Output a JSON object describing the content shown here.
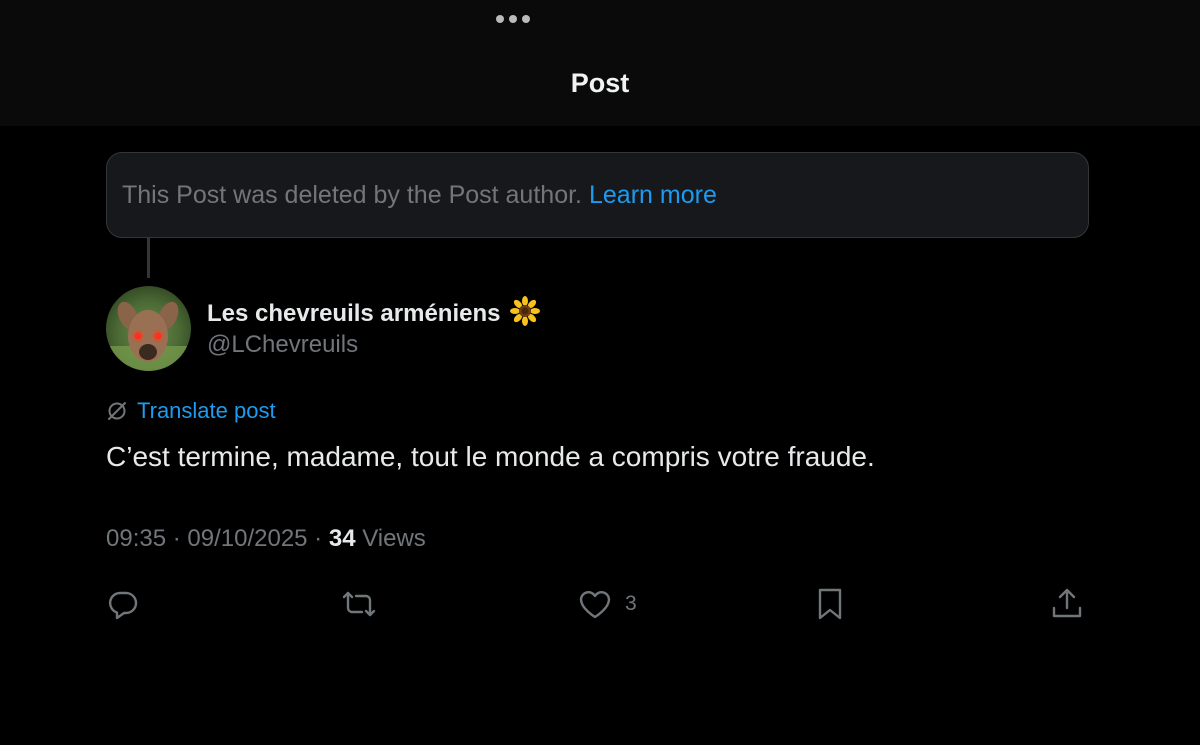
{
  "header": {
    "title": "Post",
    "grabber_icon": "more-dots-icon"
  },
  "deleted_notice": {
    "text": "This Post was deleted by the Post author.",
    "link": "Learn more"
  },
  "author": {
    "display_name": "Les chevreuils arméniens",
    "badge_emoji": "🌻",
    "handle": "@LChevreuils",
    "avatar_icon": "deer-avatar"
  },
  "translate_label": "Translate post",
  "post": {
    "text": "C’est termine, madame, tout le monde a compris votre fraude."
  },
  "meta": {
    "time": "09:35",
    "separator": " · ",
    "date": "09/10/2025",
    "views_count": "34",
    "views_label": " Views"
  },
  "actions": {
    "reply_icon": "reply-icon",
    "repost_icon": "repost-icon",
    "like_icon": "heart-icon",
    "like_count": "3",
    "bookmark_icon": "bookmark-icon",
    "share_icon": "share-icon"
  },
  "colors": {
    "background": "#000000",
    "header_bg": "#0a0a0a",
    "accent": "#1d9bf0",
    "muted_text": "#71767b",
    "primary_text": "#e7e9ea"
  }
}
